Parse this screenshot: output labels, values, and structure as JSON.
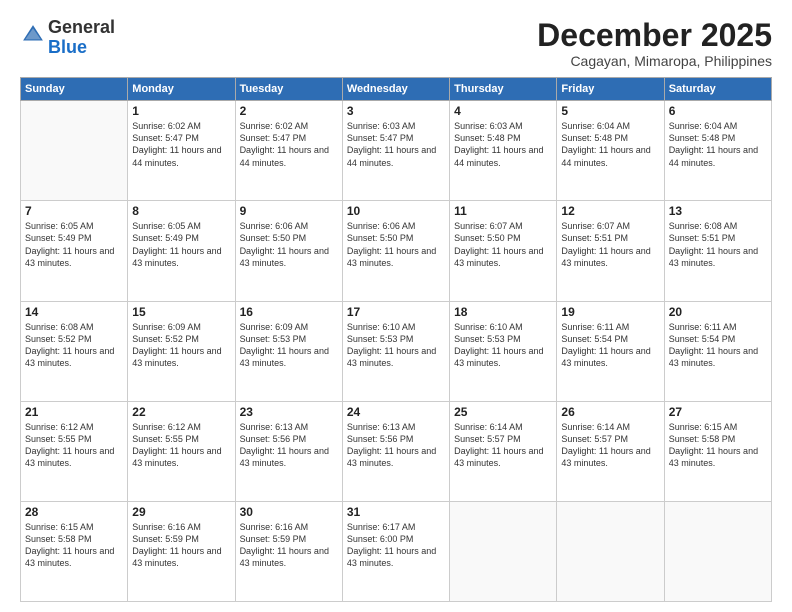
{
  "logo": {
    "general": "General",
    "blue": "Blue"
  },
  "title": "December 2025",
  "subtitle": "Cagayan, Mimaropa, Philippines",
  "weekdays": [
    "Sunday",
    "Monday",
    "Tuesday",
    "Wednesday",
    "Thursday",
    "Friday",
    "Saturday"
  ],
  "weeks": [
    [
      {
        "day": "",
        "sunrise": "",
        "sunset": "",
        "daylight": ""
      },
      {
        "day": "1",
        "sunrise": "Sunrise: 6:02 AM",
        "sunset": "Sunset: 5:47 PM",
        "daylight": "Daylight: 11 hours and 44 minutes."
      },
      {
        "day": "2",
        "sunrise": "Sunrise: 6:02 AM",
        "sunset": "Sunset: 5:47 PM",
        "daylight": "Daylight: 11 hours and 44 minutes."
      },
      {
        "day": "3",
        "sunrise": "Sunrise: 6:03 AM",
        "sunset": "Sunset: 5:47 PM",
        "daylight": "Daylight: 11 hours and 44 minutes."
      },
      {
        "day": "4",
        "sunrise": "Sunrise: 6:03 AM",
        "sunset": "Sunset: 5:48 PM",
        "daylight": "Daylight: 11 hours and 44 minutes."
      },
      {
        "day": "5",
        "sunrise": "Sunrise: 6:04 AM",
        "sunset": "Sunset: 5:48 PM",
        "daylight": "Daylight: 11 hours and 44 minutes."
      },
      {
        "day": "6",
        "sunrise": "Sunrise: 6:04 AM",
        "sunset": "Sunset: 5:48 PM",
        "daylight": "Daylight: 11 hours and 44 minutes."
      }
    ],
    [
      {
        "day": "7",
        "sunrise": "Sunrise: 6:05 AM",
        "sunset": "Sunset: 5:49 PM",
        "daylight": "Daylight: 11 hours and 43 minutes."
      },
      {
        "day": "8",
        "sunrise": "Sunrise: 6:05 AM",
        "sunset": "Sunset: 5:49 PM",
        "daylight": "Daylight: 11 hours and 43 minutes."
      },
      {
        "day": "9",
        "sunrise": "Sunrise: 6:06 AM",
        "sunset": "Sunset: 5:50 PM",
        "daylight": "Daylight: 11 hours and 43 minutes."
      },
      {
        "day": "10",
        "sunrise": "Sunrise: 6:06 AM",
        "sunset": "Sunset: 5:50 PM",
        "daylight": "Daylight: 11 hours and 43 minutes."
      },
      {
        "day": "11",
        "sunrise": "Sunrise: 6:07 AM",
        "sunset": "Sunset: 5:50 PM",
        "daylight": "Daylight: 11 hours and 43 minutes."
      },
      {
        "day": "12",
        "sunrise": "Sunrise: 6:07 AM",
        "sunset": "Sunset: 5:51 PM",
        "daylight": "Daylight: 11 hours and 43 minutes."
      },
      {
        "day": "13",
        "sunrise": "Sunrise: 6:08 AM",
        "sunset": "Sunset: 5:51 PM",
        "daylight": "Daylight: 11 hours and 43 minutes."
      }
    ],
    [
      {
        "day": "14",
        "sunrise": "Sunrise: 6:08 AM",
        "sunset": "Sunset: 5:52 PM",
        "daylight": "Daylight: 11 hours and 43 minutes."
      },
      {
        "day": "15",
        "sunrise": "Sunrise: 6:09 AM",
        "sunset": "Sunset: 5:52 PM",
        "daylight": "Daylight: 11 hours and 43 minutes."
      },
      {
        "day": "16",
        "sunrise": "Sunrise: 6:09 AM",
        "sunset": "Sunset: 5:53 PM",
        "daylight": "Daylight: 11 hours and 43 minutes."
      },
      {
        "day": "17",
        "sunrise": "Sunrise: 6:10 AM",
        "sunset": "Sunset: 5:53 PM",
        "daylight": "Daylight: 11 hours and 43 minutes."
      },
      {
        "day": "18",
        "sunrise": "Sunrise: 6:10 AM",
        "sunset": "Sunset: 5:53 PM",
        "daylight": "Daylight: 11 hours and 43 minutes."
      },
      {
        "day": "19",
        "sunrise": "Sunrise: 6:11 AM",
        "sunset": "Sunset: 5:54 PM",
        "daylight": "Daylight: 11 hours and 43 minutes."
      },
      {
        "day": "20",
        "sunrise": "Sunrise: 6:11 AM",
        "sunset": "Sunset: 5:54 PM",
        "daylight": "Daylight: 11 hours and 43 minutes."
      }
    ],
    [
      {
        "day": "21",
        "sunrise": "Sunrise: 6:12 AM",
        "sunset": "Sunset: 5:55 PM",
        "daylight": "Daylight: 11 hours and 43 minutes."
      },
      {
        "day": "22",
        "sunrise": "Sunrise: 6:12 AM",
        "sunset": "Sunset: 5:55 PM",
        "daylight": "Daylight: 11 hours and 43 minutes."
      },
      {
        "day": "23",
        "sunrise": "Sunrise: 6:13 AM",
        "sunset": "Sunset: 5:56 PM",
        "daylight": "Daylight: 11 hours and 43 minutes."
      },
      {
        "day": "24",
        "sunrise": "Sunrise: 6:13 AM",
        "sunset": "Sunset: 5:56 PM",
        "daylight": "Daylight: 11 hours and 43 minutes."
      },
      {
        "day": "25",
        "sunrise": "Sunrise: 6:14 AM",
        "sunset": "Sunset: 5:57 PM",
        "daylight": "Daylight: 11 hours and 43 minutes."
      },
      {
        "day": "26",
        "sunrise": "Sunrise: 6:14 AM",
        "sunset": "Sunset: 5:57 PM",
        "daylight": "Daylight: 11 hours and 43 minutes."
      },
      {
        "day": "27",
        "sunrise": "Sunrise: 6:15 AM",
        "sunset": "Sunset: 5:58 PM",
        "daylight": "Daylight: 11 hours and 43 minutes."
      }
    ],
    [
      {
        "day": "28",
        "sunrise": "Sunrise: 6:15 AM",
        "sunset": "Sunset: 5:58 PM",
        "daylight": "Daylight: 11 hours and 43 minutes."
      },
      {
        "day": "29",
        "sunrise": "Sunrise: 6:16 AM",
        "sunset": "Sunset: 5:59 PM",
        "daylight": "Daylight: 11 hours and 43 minutes."
      },
      {
        "day": "30",
        "sunrise": "Sunrise: 6:16 AM",
        "sunset": "Sunset: 5:59 PM",
        "daylight": "Daylight: 11 hours and 43 minutes."
      },
      {
        "day": "31",
        "sunrise": "Sunrise: 6:17 AM",
        "sunset": "Sunset: 6:00 PM",
        "daylight": "Daylight: 11 hours and 43 minutes."
      },
      {
        "day": "",
        "sunrise": "",
        "sunset": "",
        "daylight": ""
      },
      {
        "day": "",
        "sunrise": "",
        "sunset": "",
        "daylight": ""
      },
      {
        "day": "",
        "sunrise": "",
        "sunset": "",
        "daylight": ""
      }
    ]
  ]
}
